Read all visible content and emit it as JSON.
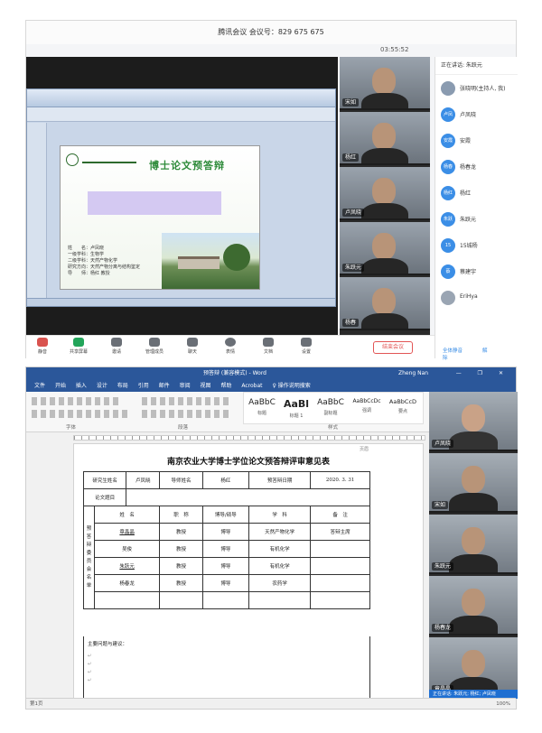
{
  "meeting": {
    "title": "腾讯会议  会议号：829 675 675",
    "timer": "03:55:52",
    "slide": {
      "title": "博士论文预答辩",
      "info": [
        "姓　　名：卢凤晓",
        "一级学科：生物学",
        "二级学科：天然产物化学",
        "研究方向：天然产物分离与结构鉴定",
        "导　　师：杨红 教授"
      ]
    },
    "tiles": [
      {
        "name": "宋如"
      },
      {
        "name": "杨红"
      },
      {
        "name": "卢凤晓"
      },
      {
        "name": "朱跃元"
      },
      {
        "name": "杨春"
      }
    ],
    "participants": {
      "header": "正在讲话: 朱跃元",
      "items": [
        {
          "avatar": "",
          "name": "张晓明(主持人, 我)"
        },
        {
          "avatar": "卢凤",
          "name": "卢凤晓"
        },
        {
          "avatar": "安霞",
          "name": "安霞"
        },
        {
          "avatar": "杨春",
          "name": "杨春龙"
        },
        {
          "avatar": "杨红",
          "name": "杨红"
        },
        {
          "avatar": "朱跃",
          "name": "朱跃元"
        },
        {
          "avatar": "15",
          "name": "15城杨"
        },
        {
          "avatar": "蔡",
          "name": "蔡建宇"
        },
        {
          "avatar": "",
          "name": "EriHya"
        }
      ],
      "footer": [
        "全体静音",
        "解除"
      ]
    },
    "toolbar": [
      "静音",
      "共享屏幕",
      "邀请",
      "管理成员",
      "聊天",
      "表情",
      "文档",
      "设置"
    ],
    "end_button": "结束会议"
  },
  "word": {
    "doc_name": "预答辩 (兼容模式) - Word",
    "user": "Zheng Nan",
    "window_controls": "— ❐ ✕",
    "tabs": [
      "文件",
      "开始",
      "插入",
      "设计",
      "布局",
      "引用",
      "邮件",
      "审阅",
      "视图",
      "帮助",
      "Acrobat",
      "♀ 操作说明搜索"
    ],
    "groups": [
      "字体",
      "段落",
      "样式"
    ],
    "styles": [
      {
        "sample": "AaBbC",
        "name": "标题"
      },
      {
        "sample": "AaBl",
        "name": "标题 1"
      },
      {
        "sample": "AaBbC",
        "name": "副标题"
      },
      {
        "sample": "AaBbCcDc",
        "name": "强调"
      },
      {
        "sample": "AaBbCcD",
        "name": "要点"
      }
    ],
    "header_mark": "页眉",
    "doc_title": "南京农业大学博士学位论文预答辩评审意见表",
    "row1": [
      "研究生姓名",
      "卢凤晓",
      "导师姓名",
      "杨红",
      "预答辩日期",
      "2020. 3. 31"
    ],
    "row2_label": "论文题目",
    "committee_label": "预答辩委员会名单",
    "committee_head": [
      "姓　名",
      "职　称",
      "博导/硕导",
      "学　科",
      "备　注"
    ],
    "committee_rows": [
      [
        "章晶晶",
        "教授",
        "博导",
        "天然产物化学",
        "答辩主席"
      ],
      [
        "吴俊",
        "教授",
        "博导",
        "有机化学",
        ""
      ],
      [
        "朱跃元",
        "教授",
        "博导",
        "有机化学",
        ""
      ],
      [
        "杨春龙",
        "教授",
        "博导",
        "农药学",
        ""
      ]
    ],
    "opinion_label": "主要问题与建议：",
    "status_left": "第1页",
    "status_right": "100%",
    "speaking": "正在讲话: 朱跃元; 杨红; 卢凤晓"
  },
  "word_tiles": [
    {
      "name": "卢凤晓"
    },
    {
      "name": "宋如"
    },
    {
      "name": "朱跃元"
    },
    {
      "name": "杨春龙"
    },
    {
      "name": "章晶晶"
    }
  ]
}
